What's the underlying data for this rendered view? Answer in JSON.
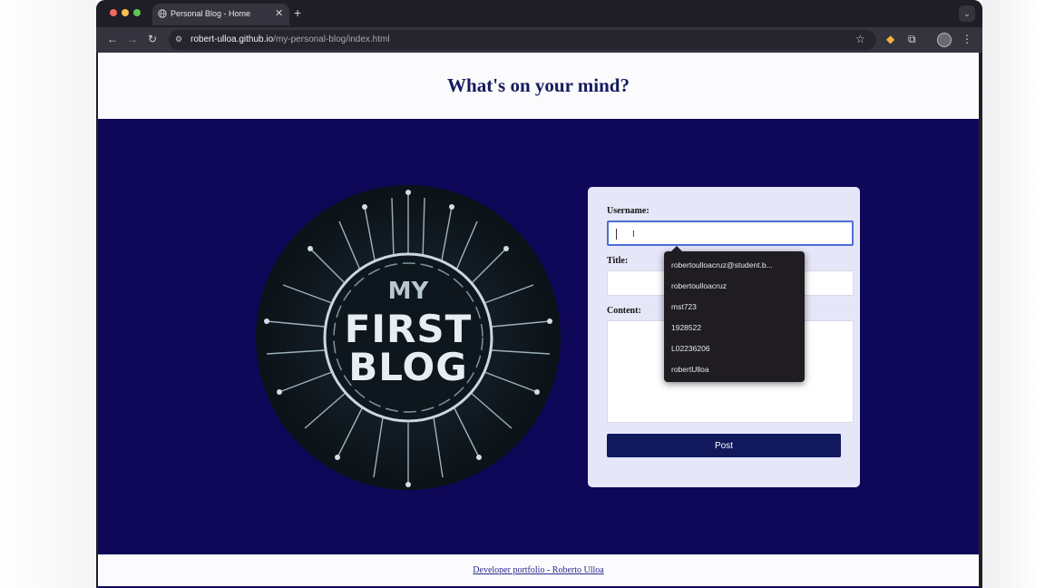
{
  "browser": {
    "tab_title": "Personal Blog - Home",
    "url_host": "robert-ulloa.github.io",
    "url_path": "/my-personal-blog/index.html"
  },
  "page": {
    "heading": "What's on your mind?",
    "logo": {
      "line1": "MY",
      "line2": "FIRST",
      "line3": "BLOG"
    },
    "form": {
      "username_label": "Username:",
      "username_value": "",
      "title_label": "Title:",
      "title_value": "",
      "content_label": "Content:",
      "content_value": "",
      "post_button": "Post"
    },
    "autocomplete": [
      "robertoulloacruz@student.b...",
      "robertoulloacruz",
      "mst723",
      "1928522",
      "L02236206",
      "robertUlloa"
    ],
    "footer_link": "Developer portfolio - Roberto Ulloa"
  },
  "colors": {
    "page_background": "#0f0758",
    "header_text": "#141a5e",
    "card_background": "#e6e6f9",
    "button": "#11195c"
  }
}
